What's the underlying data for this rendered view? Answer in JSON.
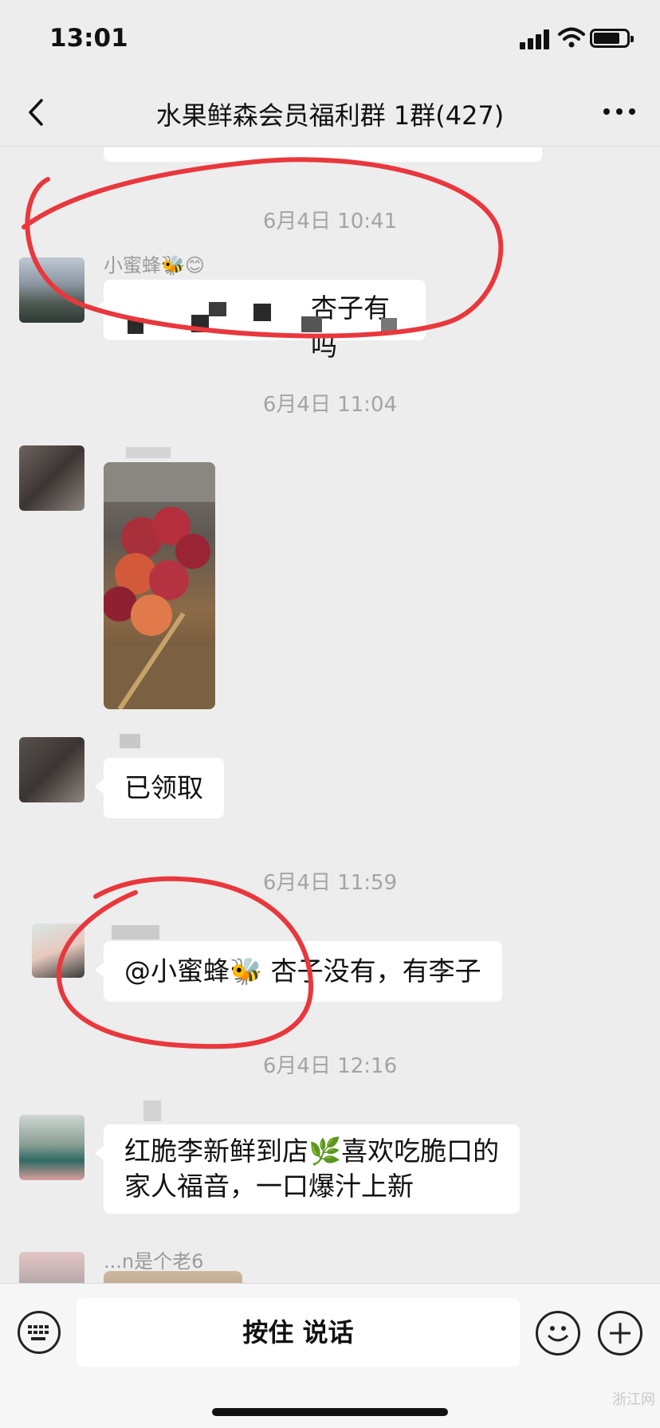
{
  "status": {
    "time": "13:01"
  },
  "nav": {
    "title": "水果鲜森会员福利群  1群(427)"
  },
  "messages": [
    {
      "timestamp": "6月4日 10:41",
      "sender": "小蜜蜂🐝😊",
      "text": "杏子有吗"
    },
    {
      "timestamp": "6月4日 11:04"
    },
    {
      "text": "已领取"
    },
    {
      "timestamp": "6月4日 11:59",
      "text": "@小蜜蜂🐝 杏子没有，有李子"
    },
    {
      "timestamp": "6月4日 12:16",
      "text_line1": "红脆李新鲜到店🌿喜欢吃脆口的",
      "text_line2": "家人福音，一口爆汁上新"
    },
    {
      "sender": "...n是个老6"
    }
  ],
  "input": {
    "voice_label": "按住 说话"
  },
  "watermark": "浙江网",
  "colors": {
    "background": "#ededed",
    "bubble": "#ffffff",
    "annotation": "#e8383d"
  }
}
